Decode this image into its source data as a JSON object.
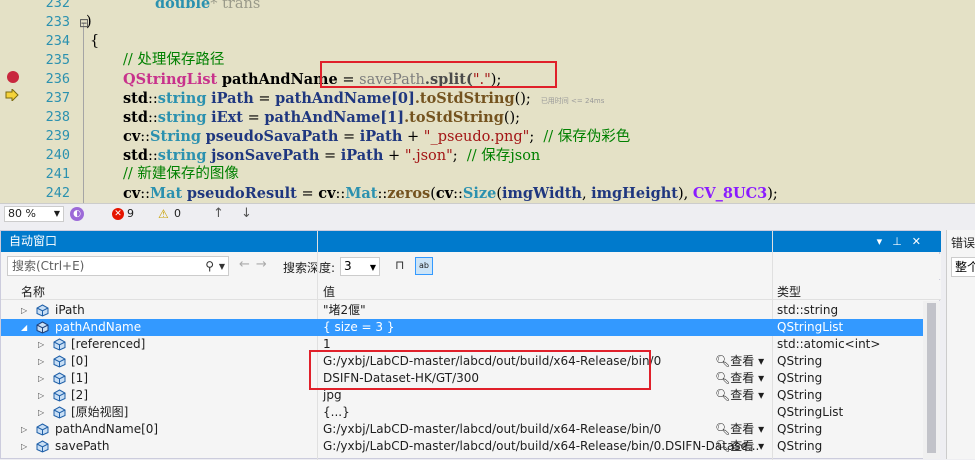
{
  "editor": {
    "lines": [
      {
        "num": "232"
      },
      {
        "num": "233"
      },
      {
        "num": "234"
      },
      {
        "num": "235"
      },
      {
        "num": "236"
      },
      {
        "num": "237"
      },
      {
        "num": "238"
      },
      {
        "num": "239"
      },
      {
        "num": "240"
      },
      {
        "num": "241"
      },
      {
        "num": "242"
      }
    ],
    "code": {
      "l232_type": "double",
      "l232_rest": "* trans",
      "l233": ")",
      "l234": "{",
      "l235": "// 处理保存路径",
      "l236_type": "QStringList",
      "l236_var": "pathAndName",
      "l236_eq": " = ",
      "l236_arg": "savePath",
      "l236_fn": ".split(",
      "l236_str": "\".\"",
      "l236_end": ");",
      "l237_ns": "std",
      "l237_type": "string",
      "l237_var": "iPath",
      "l237_rhs": "pathAndName[0]",
      "l237_fn": ".toStdString",
      "l237_end": "();",
      "l237_elapsed": "已用时间 <= 24ms",
      "l238_ns": "std",
      "l238_type": "string",
      "l238_var": "iExt",
      "l238_rhs": "pathAndName[1]",
      "l238_fn": ".toStdString",
      "l238_end": "();",
      "l239_ns": "cv",
      "l239_type": "String",
      "l239_var": "pseudoSavaPath",
      "l239_rhs": "iPath",
      "l239_str": "\"_pseudo.png\"",
      "l239_cmt": "// 保存伪彩色",
      "l240_ns": "std",
      "l240_type": "string",
      "l240_var": "jsonSavePath",
      "l240_rhs": "iPath",
      "l240_str": "\".json\"",
      "l240_cmt": "// 保存json",
      "l241": "// 新建保存的图像",
      "l242_ns": "cv",
      "l242_type": "Mat",
      "l242_var": "pseudoResult",
      "l242_ns2": "cv",
      "l242_type2": "Mat",
      "l242_fn": "zeros",
      "l242_ns3": "cv",
      "l242_type3": "Size",
      "l242_a1": "imgWidth",
      "l242_a2": "imgHeight",
      "l242_macro": "CV_8UC3",
      "l242_end": ");"
    }
  },
  "editor_status": {
    "zoom": "80 %",
    "errors": "9",
    "warnings": "0"
  },
  "autos": {
    "title": "自动窗口",
    "search_placeholder": "搜索(Ctrl+E)",
    "depth_label": "搜索深度:",
    "depth_value": "3",
    "columns": {
      "name": "名称",
      "value": "值",
      "type": "类型"
    },
    "view_label": "查看",
    "rows": [
      {
        "name": "iPath",
        "value": "\"堵2偃\"",
        "type": "std::string"
      },
      {
        "name": "pathAndName",
        "value": "{ size = 3 }",
        "type": "QStringList"
      },
      {
        "name": "[referenced]",
        "value": "1",
        "type": "std::atomic<int>"
      },
      {
        "name": "[0]",
        "value": "G:/yxbj/LabCD-master/labcd/out/build/x64-Release/bin/0",
        "type": "QString"
      },
      {
        "name": "[1]",
        "value": "DSIFN-Dataset-HK/GT/300",
        "type": "QString"
      },
      {
        "name": "[2]",
        "value": "jpg",
        "type": "QString"
      },
      {
        "name": "[原始视图]",
        "value": "{...}",
        "type": "QStringList"
      },
      {
        "name": "pathAndName[0]",
        "value": "G:/yxbj/LabCD-master/labcd/out/build/x64-Release/bin/0",
        "type": "QString"
      },
      {
        "name": "savePath",
        "value": "G:/yxbj/LabCD-master/labcd/out/build/x64-Release/bin/0.DSIFN-Datase...",
        "type": "QString"
      }
    ]
  },
  "error_panel": {
    "title": "错误",
    "scope": "整个"
  },
  "colors": {
    "accent": "#007acc",
    "selection": "#3399ff",
    "highlight_box": "#e0202a",
    "editor_bg": "#e4e1c6"
  }
}
